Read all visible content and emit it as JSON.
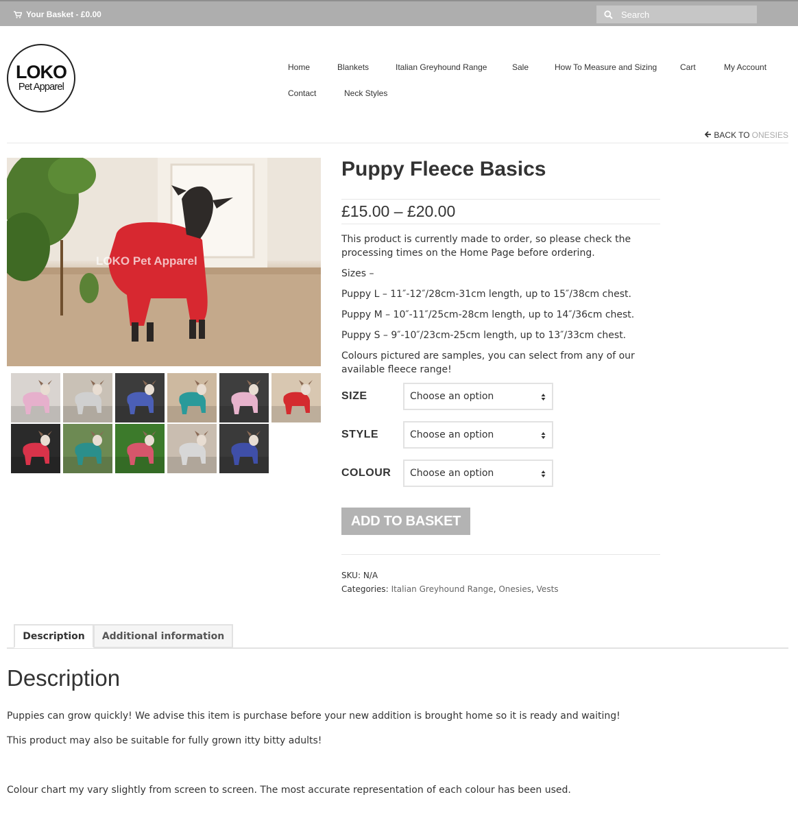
{
  "topbar": {
    "basket_label": "Your Basket - £0.00",
    "search_placeholder": "Search"
  },
  "logo": {
    "line1": "LOKO",
    "line2": "Pet Apparel"
  },
  "nav": {
    "items": [
      "Home",
      "Blankets",
      "Italian Greyhound Range",
      "Sale",
      "How To Measure and Sizing",
      "Cart",
      "My Account",
      "Contact",
      "Neck Styles"
    ]
  },
  "breadcrumb": {
    "back_label": "BACK TO",
    "back_target": "ONESIES"
  },
  "gallery": {
    "watermark": "LOKO Pet Apparel",
    "thumbnails": [
      {
        "name": "pink-blanket",
        "bg": "#d9d4d0",
        "coat": "#e6b0cc"
      },
      {
        "name": "grey-standing",
        "bg": "#c9c1b6",
        "coat": "#d0d0d0"
      },
      {
        "name": "blue-sofa",
        "bg": "#3c3c3c",
        "coat": "#4b5fb6"
      },
      {
        "name": "teal-standing",
        "bg": "#cdb9a0",
        "coat": "#2a9a9a"
      },
      {
        "name": "pink-sofa",
        "bg": "#3e3e3e",
        "coat": "#e7b3cc"
      },
      {
        "name": "red-standing",
        "bg": "#d8c7b1",
        "coat": "#d42b2f"
      },
      {
        "name": "red-fireplace",
        "bg": "#2a2a2a",
        "coat": "#d9334a"
      },
      {
        "name": "teal-plants",
        "bg": "#6d8a53",
        "coat": "#2b8f8b"
      },
      {
        "name": "pink-grass",
        "bg": "#3c7a2b",
        "coat": "#d6566b"
      },
      {
        "name": "grey-floor",
        "bg": "#c9bdb0",
        "coat": "#d7d7d7"
      },
      {
        "name": "blue-sitting",
        "bg": "#3a3a3a",
        "coat": "#3f4fa8"
      }
    ]
  },
  "product": {
    "title": "Puppy Fleece Basics",
    "price": "£15.00 – £20.00",
    "description": [
      "This product is currently made to order, so please check the processing times on the Home Page before ordering.",
      "Sizes –",
      "Puppy L – 11″-12″/28cm-31cm length, up to 15″/38cm chest.",
      "Puppy M – 10″-11″/25cm-28cm length, up to 14″/36cm chest.",
      "Puppy S – 9″-10″/23cm-25cm length, up to 13″/33cm chest.",
      "Colours pictured are samples, you can select from any of our available fleece range!"
    ],
    "attributes": [
      {
        "label": "SIZE",
        "value": "Choose an option"
      },
      {
        "label": "STYLE",
        "value": "Choose an option"
      },
      {
        "label": "COLOUR",
        "value": "Choose an option"
      }
    ],
    "add_button": "ADD TO BASKET",
    "sku_label": "SKU:",
    "sku_value": "N/A",
    "categories_label": "Categories:",
    "categories": [
      "Italian Greyhound Range",
      "Onesies",
      "Vests"
    ],
    "categories_sep": ","
  },
  "tabs": {
    "description": "Description",
    "additional": "Additional information"
  },
  "description_panel": {
    "heading": "Description",
    "paragraphs": [
      "Puppies can grow quickly! We advise this item is purchase before your new addition is brought home so it is ready and waiting!",
      "This product may also be suitable for fully grown itty bitty adults!",
      "Colour chart my vary slightly from screen to screen. The most accurate representation of each colour has been used."
    ]
  }
}
